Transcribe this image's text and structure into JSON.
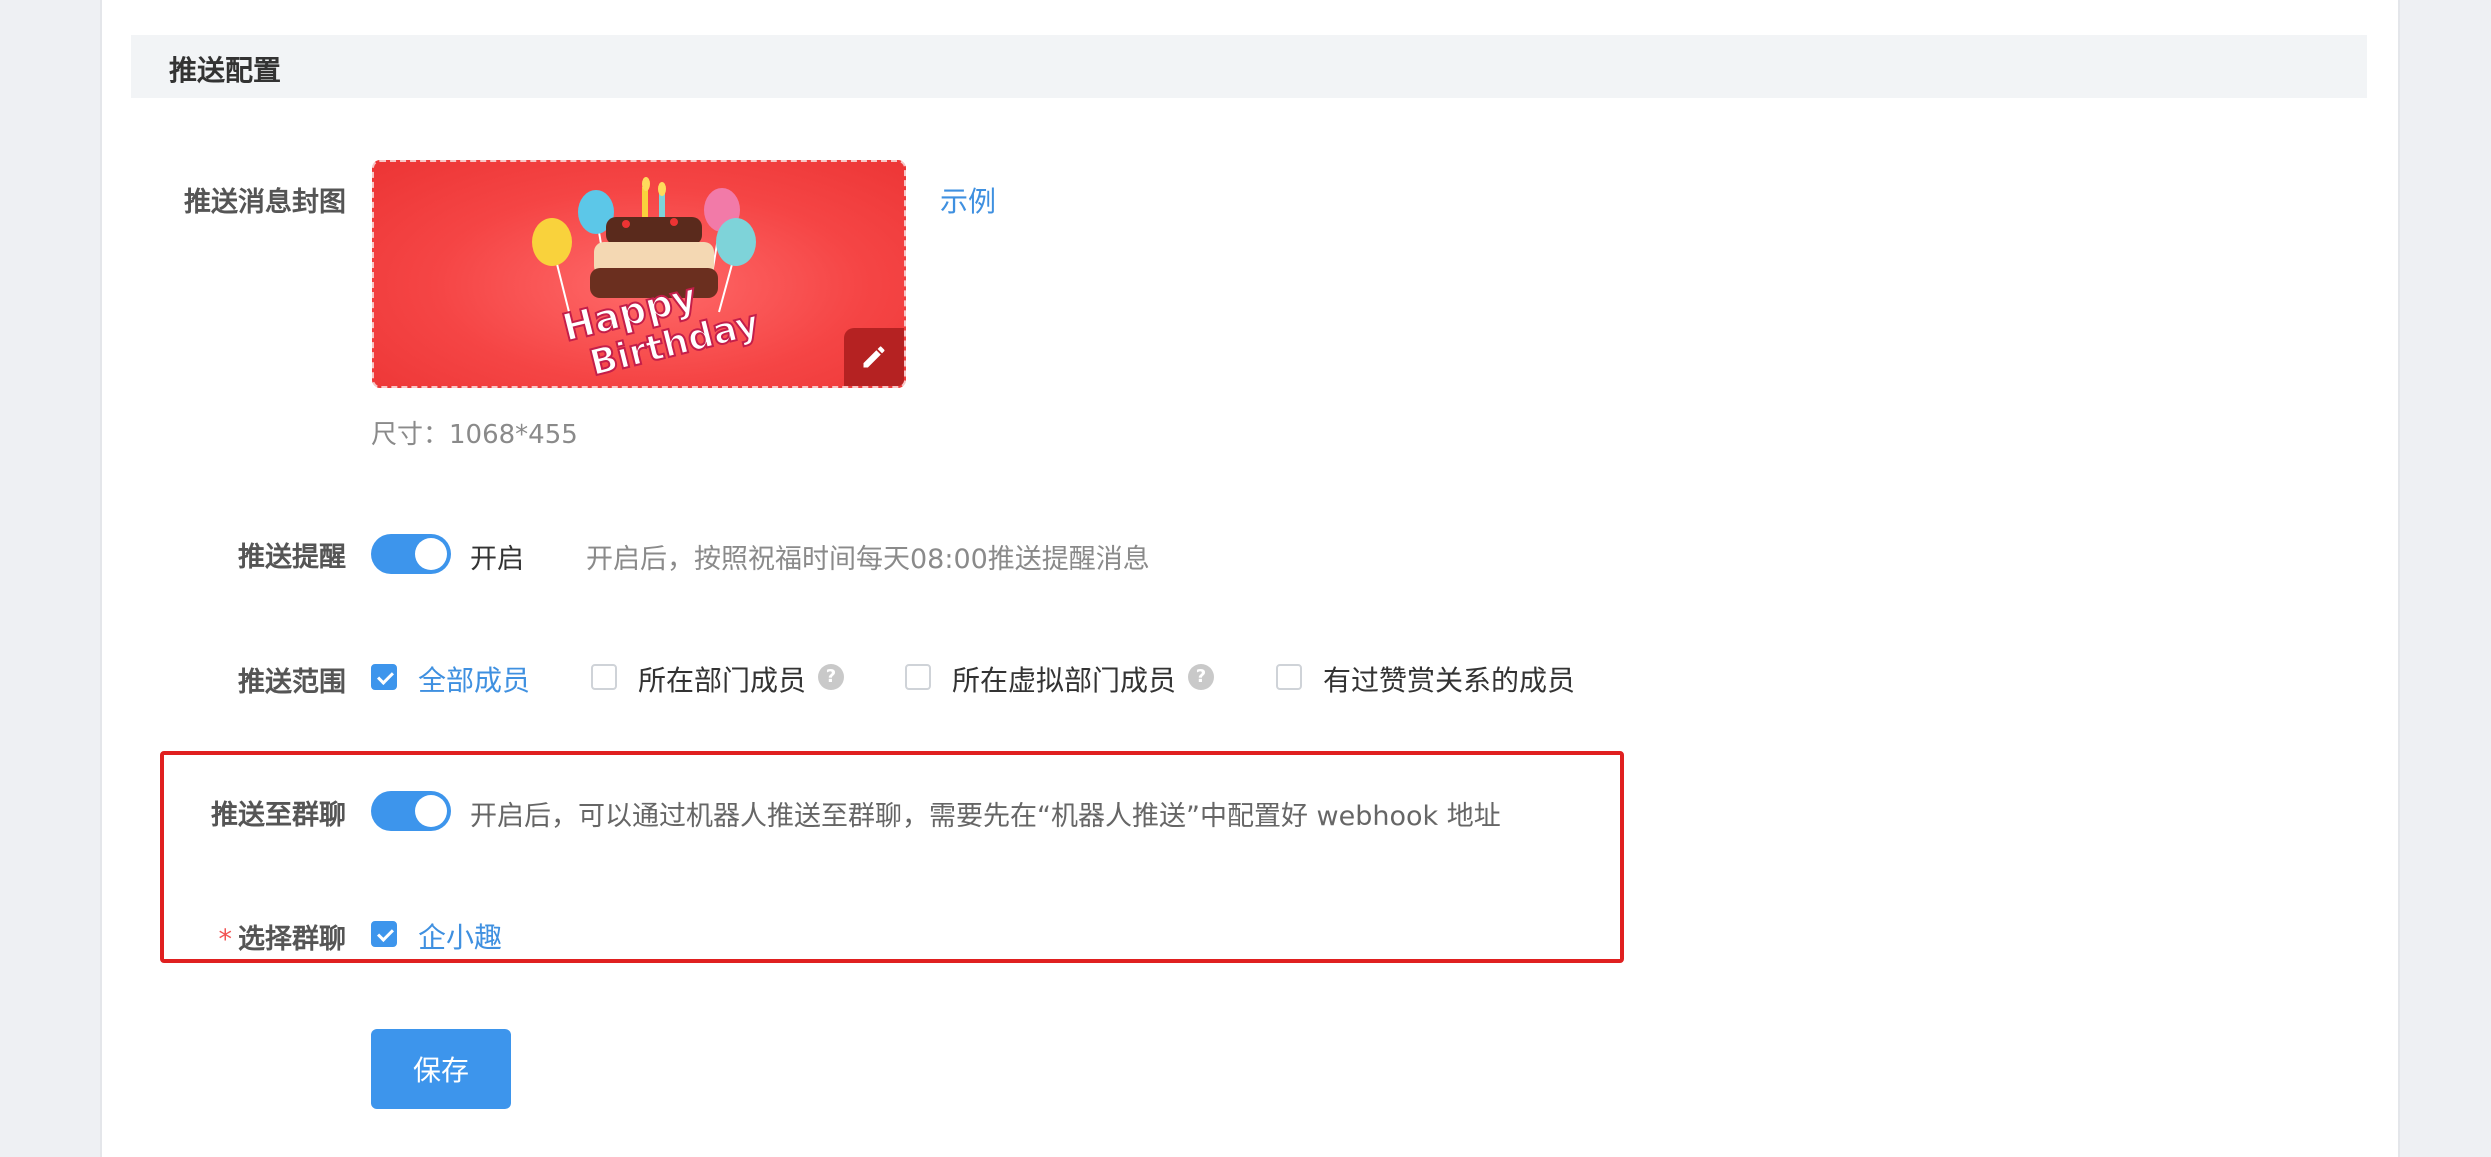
{
  "section": {
    "title": "推送配置"
  },
  "cover": {
    "label": "推送消息封图",
    "example_link": "示例",
    "size_hint": "尺寸：1068*455",
    "image_text_line1": "Happy",
    "image_text_line2": "Birthday",
    "edit_icon": "pencil-icon"
  },
  "reminder": {
    "label": "推送提醒",
    "toggle_on": true,
    "toggle_text": "开启",
    "hint": "开启后，按照祝福时间每天08:00推送提醒消息"
  },
  "scope": {
    "label": "推送范围",
    "options": [
      {
        "label": "全部成员",
        "checked": true,
        "help": false
      },
      {
        "label": "所在部门成员",
        "checked": false,
        "help": true
      },
      {
        "label": "所在虚拟部门成员",
        "checked": false,
        "help": true
      },
      {
        "label": "有过赞赏关系的成员",
        "checked": false,
        "help": false
      }
    ],
    "help_glyph": "?"
  },
  "group_push": {
    "label": "推送至群聊",
    "toggle_on": true,
    "hint": "开启后，可以通过机器人推送至群聊，需要先在“机器人推送”中配置好 webhook 地址"
  },
  "select_group": {
    "required_mark": "*",
    "label": "选择群聊",
    "options": [
      {
        "label": "企小趣",
        "checked": true
      }
    ]
  },
  "actions": {
    "save_label": "保存"
  },
  "colors": {
    "primary": "#3d95ec",
    "link": "#3f90e0",
    "highlight_border": "#e02020",
    "cover_bg": "#f54545"
  }
}
